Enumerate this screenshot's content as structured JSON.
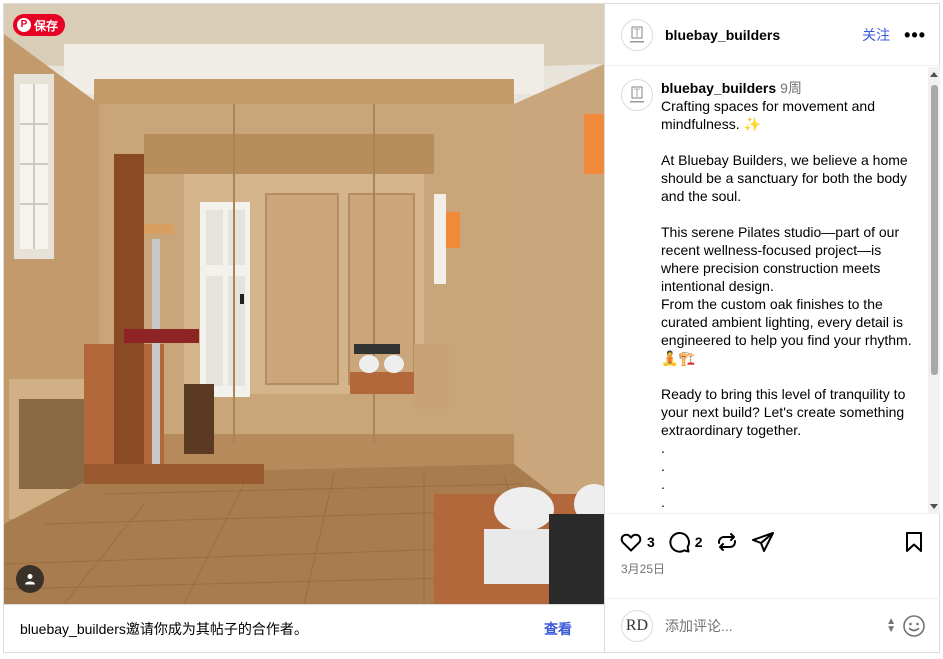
{
  "media": {
    "save_badge": "保存",
    "collab_text": "bluebay_builders邀请你成为其帖子的合作者。",
    "view_label": "查看"
  },
  "header": {
    "username": "bluebay_builders",
    "follow_label": "关注",
    "more_label": "•••"
  },
  "caption": {
    "username": "bluebay_builders",
    "time": "9周",
    "text": "Crafting spaces for movement and mindfulness. ✨\n\nAt Bluebay Builders, we believe a home should be a sanctuary for both the body and the soul.\n\nThis serene Pilates studio—part of our recent wellness-focused project—is where precision construction meets intentional design.\nFrom the custom oak finishes to the curated ambient lighting, every detail is engineered to help you find your rhythm. 🧘🏗️\n\nReady to bring this level of tranquility to your next build? Let's create something extraordinary together.\n.\n.\n.\n.\n."
  },
  "actions": {
    "likes": "3",
    "comments": "2"
  },
  "date": "3月25日",
  "comment": {
    "avatar_text": "RD",
    "placeholder": "添加评论..."
  },
  "colors": {
    "accent": "#3b5bdb",
    "pinterest": "#e60023",
    "border": "#dbdbdb"
  },
  "icons": [
    "heart-icon",
    "comment-icon",
    "repost-icon",
    "share-icon",
    "bookmark-icon",
    "emoji-icon",
    "more-icon",
    "user-tag-icon",
    "pinterest-icon"
  ]
}
